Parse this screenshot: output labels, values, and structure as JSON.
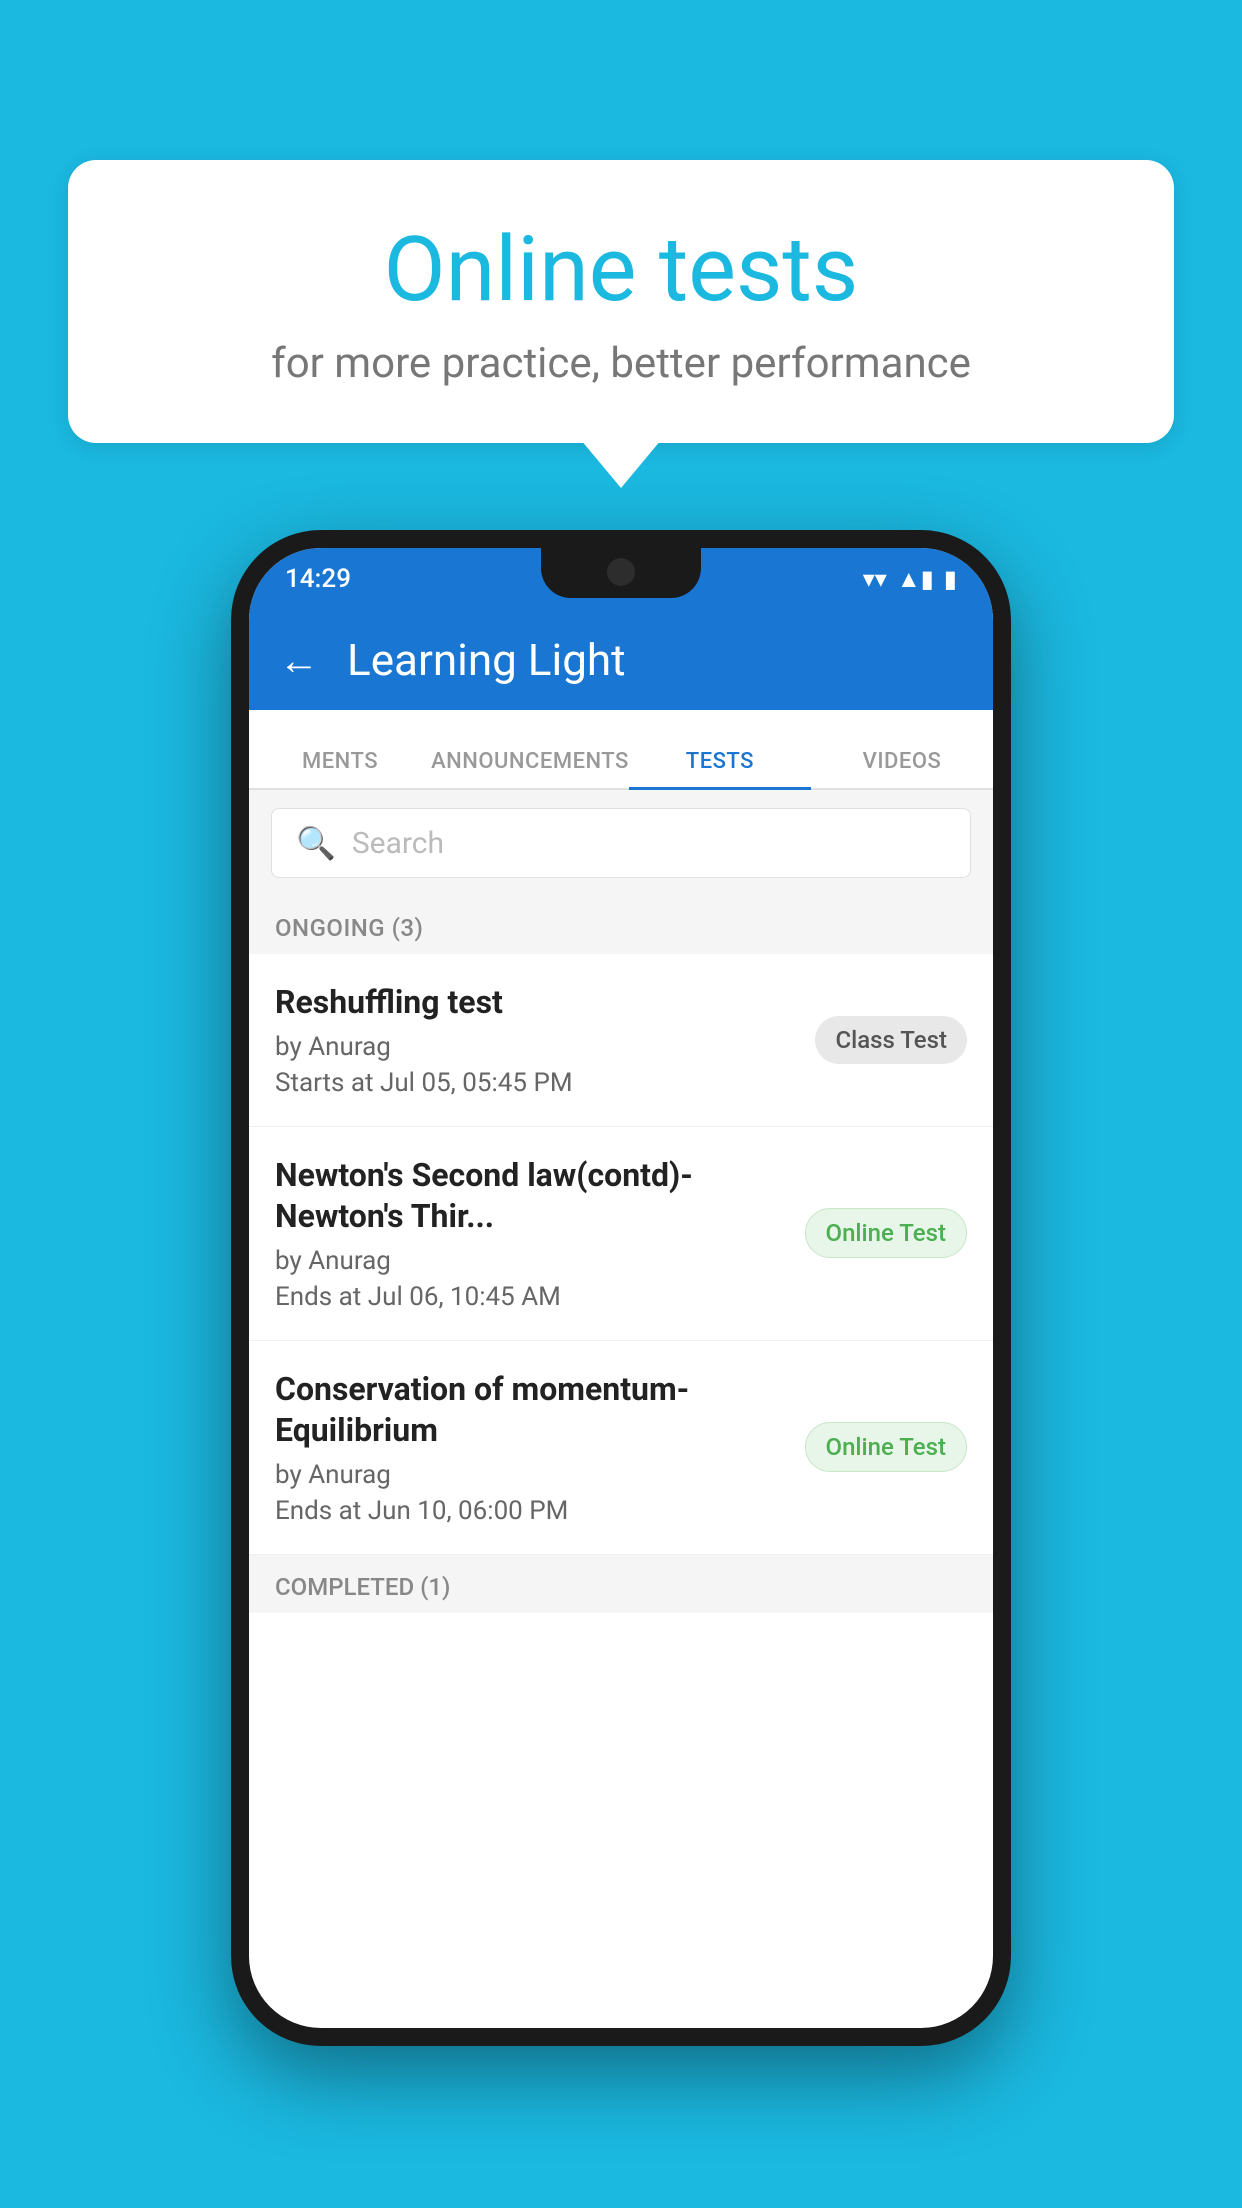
{
  "background": {
    "color": "#1BB8E0"
  },
  "bubble": {
    "title": "Online tests",
    "subtitle": "for more practice, better performance"
  },
  "phone": {
    "status_bar": {
      "time": "14:29",
      "wifi": "▼",
      "signal": "▲",
      "battery": "▮"
    },
    "header": {
      "back_label": "←",
      "title": "Learning Light"
    },
    "tabs": [
      {
        "label": "MENTS",
        "active": false
      },
      {
        "label": "ANNOUNCEMENTS",
        "active": false
      },
      {
        "label": "TESTS",
        "active": true
      },
      {
        "label": "VIDEOS",
        "active": false
      }
    ],
    "search": {
      "placeholder": "Search"
    },
    "sections": [
      {
        "title": "ONGOING (3)",
        "items": [
          {
            "name": "Reshuffling test",
            "author": "by Anurag",
            "time": "Starts at  Jul 05, 05:45 PM",
            "badge": "Class Test",
            "badge_type": "class"
          },
          {
            "name": "Newton's Second law(contd)-Newton's Thir...",
            "author": "by Anurag",
            "time": "Ends at  Jul 06, 10:45 AM",
            "badge": "Online Test",
            "badge_type": "online"
          },
          {
            "name": "Conservation of momentum-Equilibrium",
            "author": "by Anurag",
            "time": "Ends at  Jun 10, 06:00 PM",
            "badge": "Online Test",
            "badge_type": "online"
          }
        ]
      },
      {
        "title": "COMPLETED (1)",
        "items": []
      }
    ]
  }
}
